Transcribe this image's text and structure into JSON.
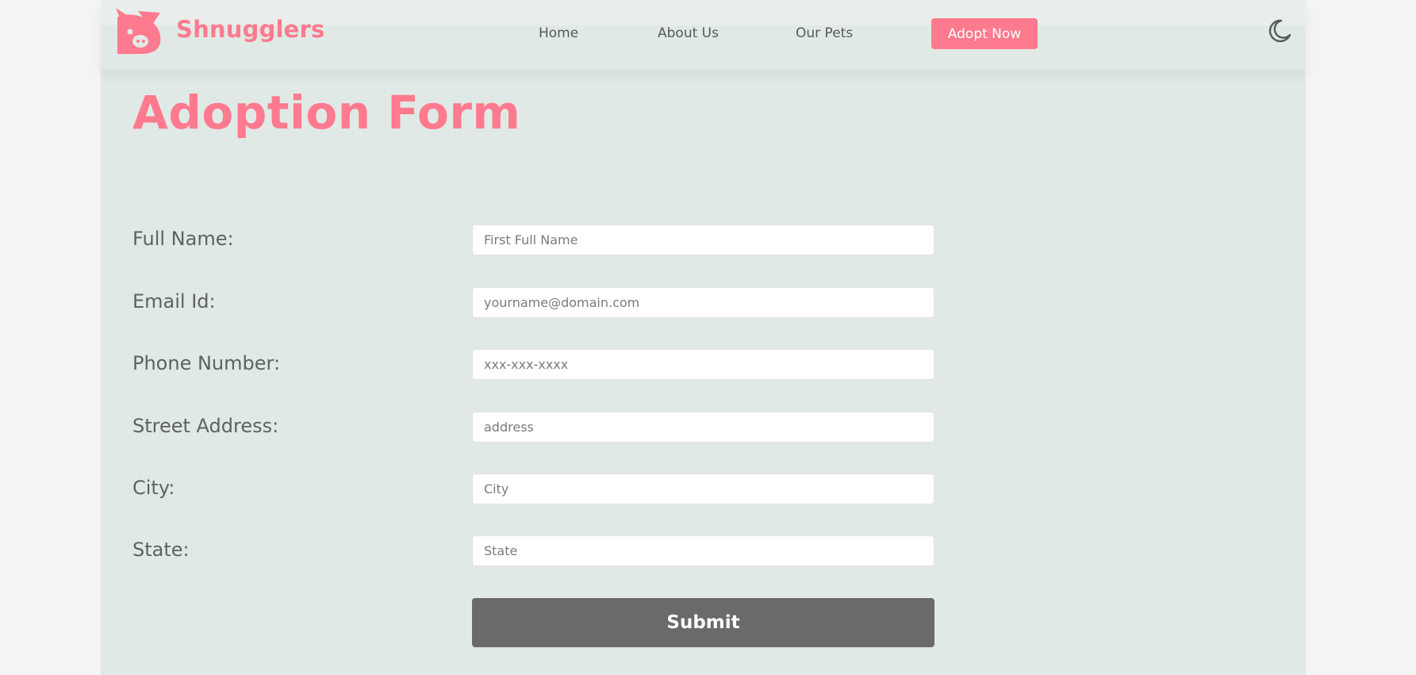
{
  "brand": {
    "name": "Shnugglers",
    "logo_icon": "pig-face-icon",
    "accent_color": "#fe7a8e"
  },
  "nav": {
    "items": [
      {
        "label": "Home"
      },
      {
        "label": "About Us"
      },
      {
        "label": "Our Pets"
      }
    ],
    "cta_label": "Adopt Now",
    "theme_toggle_icon": "moon-icon"
  },
  "main": {
    "title": "Adoption Form"
  },
  "form": {
    "fields": [
      {
        "label": "Full Name:",
        "placeholder": "First Full Name",
        "value": ""
      },
      {
        "label": "Email Id:",
        "placeholder": "yourname@domain.com",
        "value": ""
      },
      {
        "label": "Phone Number:",
        "placeholder": "xxx-xxx-xxxx",
        "value": ""
      },
      {
        "label": "Street Address:",
        "placeholder": "address",
        "value": ""
      },
      {
        "label": "City:",
        "placeholder": "City",
        "value": ""
      },
      {
        "label": "State:",
        "placeholder": "State",
        "value": ""
      }
    ],
    "submit_label": "Submit"
  },
  "colors": {
    "card_background": "#e1e9e6",
    "page_background": "#f4f4f4",
    "submit_button": "#6a6a6a",
    "label_text": "#5d6262"
  }
}
